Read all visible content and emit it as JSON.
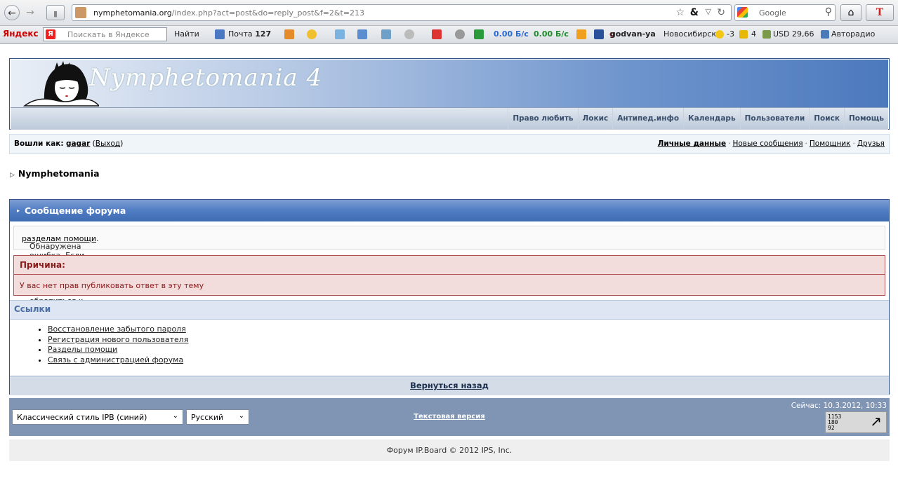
{
  "browser": {
    "url_host": "nymphetomania.org",
    "url_rest": "/index.php?act=post&do=reply_post&f=2&t=213",
    "search_placeholder": "Google"
  },
  "yandex_bar": {
    "logo": "Яндекс",
    "search_placeholder": "Поискать в Яндексе",
    "find": "Найти",
    "mail_label": "Почта",
    "mail_count": "127",
    "speed_down": "0.00 Б/с",
    "speed_up": "0.00 Б/с",
    "user": "godvan-ya",
    "city": "Новосибирск",
    "weather": "-3",
    "traffic": "4",
    "usd": "USD 29,66",
    "radio": "Авторадио"
  },
  "site": {
    "title": "Nymphetomania 4",
    "menu": [
      "Право любить",
      "Локис",
      "Антипед.инфо",
      "Календарь",
      "Пользователи",
      "Поиск",
      "Помощь"
    ]
  },
  "userbar": {
    "logged_as": "Вошли как:",
    "username": "gagar",
    "logout": "Выход",
    "links": [
      "Личные данные",
      "Новые сообщения",
      "Помощник",
      "Друзья"
    ]
  },
  "breadcrumb": "Nymphetomania",
  "message": {
    "header": "Сообщение форума",
    "text": "Обнаружена ошибка. Если вам неизвестны причины ошибки, попробуйте обратиться к",
    "help_link": "разделам помощи",
    "reason_title": "Причина:",
    "reason_text": "У вас нет прав публиковать ответ в эту тему",
    "links_title": "Ссылки",
    "links": [
      "Восстановление забытого пароля",
      "Регистрация нового пользователя",
      "Разделы помощи",
      "Связь с администрацией форума"
    ],
    "back": "Вернуться назад"
  },
  "footer": {
    "style_select": "Классический стиль IPB (синий)",
    "lang_select": "Русский",
    "text_version": "Текстовая версия",
    "now": "Сейчас: 10.3.2012, 10:33",
    "counter": [
      "1153",
      "180",
      "92"
    ],
    "copyright": "Форум IP.Board © 2012  IPS, Inc."
  }
}
